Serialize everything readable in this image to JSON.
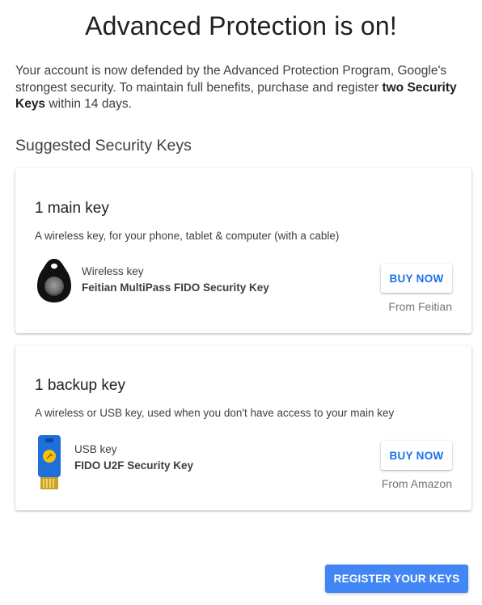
{
  "header": {
    "title": "Advanced Protection is on!"
  },
  "intro": {
    "text_before": "Your account is now defended by the Advanced Protection Program, Google's strongest security. To maintain full benefits, purchase and register ",
    "text_bold": "two Security Keys",
    "text_after": " within 14 days."
  },
  "section": {
    "title": "Suggested Security Keys"
  },
  "cards": [
    {
      "title": "1 main key",
      "description": "A wireless key, for your phone, tablet & computer (with a cable)",
      "key_type": "Wireless key",
      "key_name": "Feitian MultiPass FIDO Security Key",
      "buy_label": "BUY NOW",
      "source": "From Feitian",
      "icon": "wireless-key-icon"
    },
    {
      "title": "1 backup key",
      "description": "A wireless or USB key, used when you don't have access to your main key",
      "key_type": "USB key",
      "key_name": "FIDO U2F Security Key",
      "buy_label": "BUY NOW",
      "source": "From Amazon",
      "icon": "usb-key-icon"
    }
  ],
  "footer": {
    "register_label": "REGISTER YOUR KEYS"
  },
  "colors": {
    "accent": "#4285f4",
    "link_blue": "#1a73e8",
    "usb_key_blue": "#1e6fd9",
    "usb_key_gold": "#f4c20d"
  }
}
